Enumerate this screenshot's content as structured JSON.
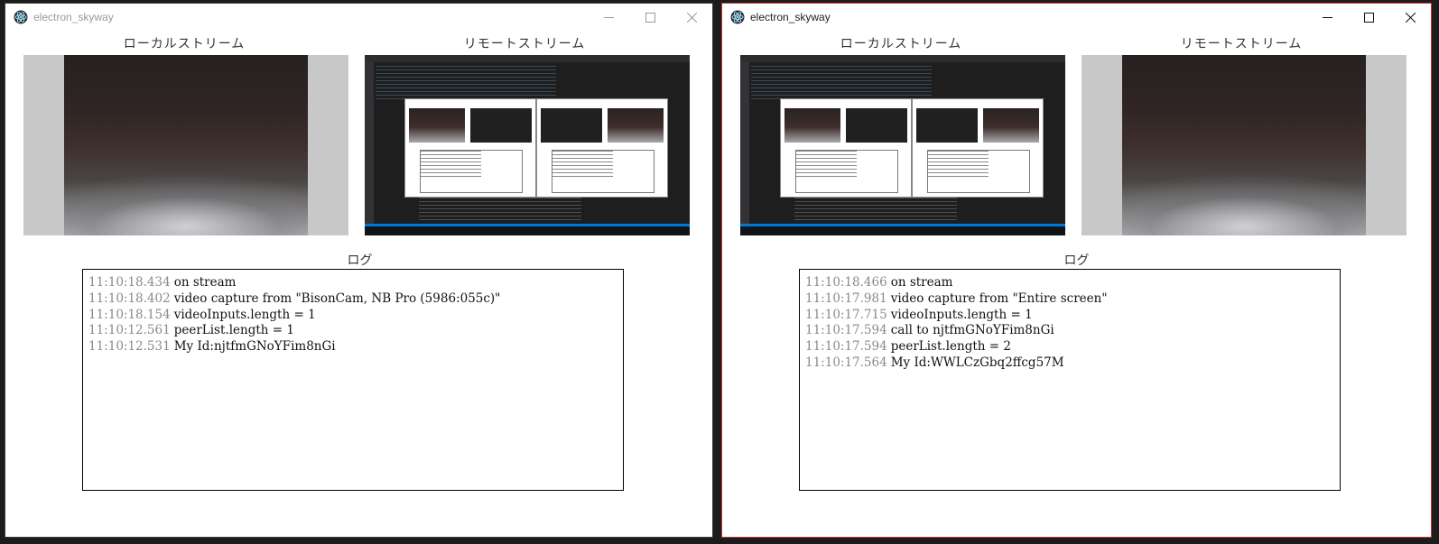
{
  "windows": [
    {
      "title": "electron_skyway",
      "local_label": "ローカルストリーム",
      "remote_label": "リモートストリーム",
      "log_label": "ログ",
      "log": [
        {
          "time": "11:10:18.434",
          "msg": "on stream"
        },
        {
          "time": "11:10:18.402",
          "msg": "video capture from \"BisonCam, NB Pro (5986:055c)\""
        },
        {
          "time": "11:10:18.154",
          "msg": "videoInputs.length = 1"
        },
        {
          "time": "11:10:12.561",
          "msg": "peerList.length = 1"
        },
        {
          "time": "11:10:12.531",
          "msg": "My Id:njtfmGNoYFim8nGi"
        }
      ]
    },
    {
      "title": "electron_skyway",
      "local_label": "ローカルストリーム",
      "remote_label": "リモートストリーム",
      "log_label": "ログ",
      "log": [
        {
          "time": "11:10:18.466",
          "msg": "on stream"
        },
        {
          "time": "11:10:17.981",
          "msg": "video capture from \"Entire screen\""
        },
        {
          "time": "11:10:17.715",
          "msg": "videoInputs.length = 1"
        },
        {
          "time": "11:10:17.594",
          "msg": "call to njtfmGNoYFim8nGi"
        },
        {
          "time": "11:10:17.594",
          "msg": "peerList.length = 2"
        },
        {
          "time": "11:10:17.564",
          "msg": "My Id:WWLCzGbq2ffcg57M"
        }
      ]
    }
  ],
  "icons": {
    "app": "electron-atom-icon",
    "minimize": "minimize-icon",
    "maximize": "maximize-icon",
    "close": "close-icon"
  },
  "colors": {
    "active_border": "#c0392b",
    "log_time": "#8a8a8a"
  }
}
